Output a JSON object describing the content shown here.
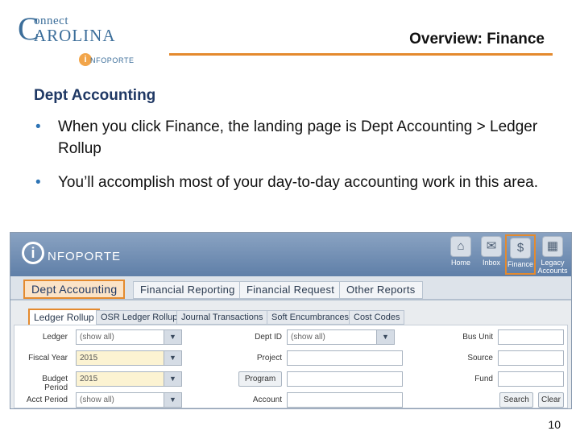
{
  "logo": {
    "line1": "onnect",
    "big_c": "C",
    "line2": "AROLINA",
    "sub_i": "i",
    "sub": "NFOPORTE"
  },
  "slide": {
    "title": "Overview: Finance",
    "heading": "Dept Accounting",
    "bullets": [
      "When you click Finance, the landing page is Dept Accounting > Ledger Rollup",
      "You’ll accomplish most of your day-to-day accounting work in this area."
    ],
    "bullet_char": "•",
    "page_number": "10"
  },
  "app": {
    "logo_i": "i",
    "logo_text": "NFOPORTE",
    "nav": [
      {
        "label": "Home",
        "icon": "⌂"
      },
      {
        "label": "Inbox",
        "icon": "✉"
      },
      {
        "label": "Finance",
        "icon": "$"
      },
      {
        "label": "Legacy Accounts",
        "icon": "▦"
      }
    ],
    "main_tabs": [
      "Dept Accounting",
      "Financial Reporting",
      "Financial Request",
      "Other Reports"
    ],
    "sub_tabs": [
      "Ledger Rollup",
      "OSR Ledger Rollup",
      "Journal Transactions",
      "Soft Encumbrances",
      "Cost Codes"
    ],
    "form": {
      "ledger_label": "Ledger",
      "ledger_value": "(show all)",
      "fiscal_year_label": "Fiscal Year",
      "fiscal_year_value": "2015",
      "budget_period_label": "Budget Period",
      "budget_period_value": "2015",
      "acct_period_label": "Acct Period",
      "acct_period_value": "(show all)",
      "deptid_label": "Dept ID",
      "deptid_value": "(show all)",
      "project_label": "Project",
      "program_button": "Program",
      "account_label": "Account",
      "bus_unit_label": "Bus Unit",
      "source_label": "Source",
      "fund_label": "Fund",
      "search_button": "Search",
      "clear_button": "Clear",
      "dropdown_icon": "▼"
    }
  },
  "colors": {
    "accent": "#e48a2e",
    "heading": "#1f3864",
    "bullet": "#2e74b5",
    "brand_blue": "#3c6e9a"
  }
}
